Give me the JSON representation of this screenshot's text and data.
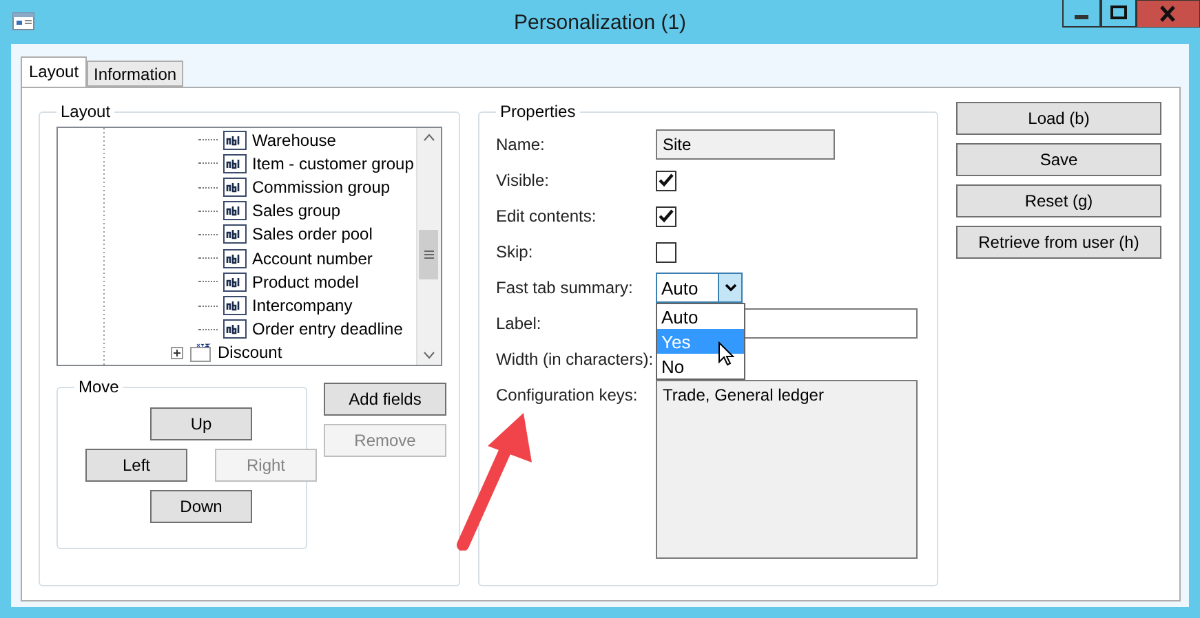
{
  "window": {
    "title": "Personalization (1)"
  },
  "tabs": [
    {
      "label": "Layout",
      "selected": true
    },
    {
      "label": "Information",
      "selected": false
    }
  ],
  "layout": {
    "title": "Layout",
    "tree": [
      {
        "kind": "field",
        "label": "Warehouse"
      },
      {
        "kind": "field",
        "label": "Item - customer group"
      },
      {
        "kind": "field",
        "label": "Commission group"
      },
      {
        "kind": "field",
        "label": "Sales group"
      },
      {
        "kind": "field",
        "label": "Sales order pool"
      },
      {
        "kind": "field",
        "label": "Account number"
      },
      {
        "kind": "field",
        "label": "Product model"
      },
      {
        "kind": "field",
        "label": "Intercompany"
      },
      {
        "kind": "field",
        "label": "Order entry deadline"
      },
      {
        "kind": "group",
        "label": "Discount",
        "expanded": false
      }
    ],
    "move": {
      "title": "Move",
      "up": {
        "label": "Up",
        "disabled": false
      },
      "left": {
        "label": "Left",
        "disabled": false
      },
      "right": {
        "label": "Right",
        "disabled": true
      },
      "down": {
        "label": "Down",
        "disabled": false
      }
    },
    "buttons": [
      {
        "label": "Add fields",
        "disabled": false
      },
      {
        "label": "Remove",
        "disabled": true
      }
    ]
  },
  "properties": {
    "title": "Properties",
    "fields": [
      {
        "kind": "text",
        "label": "Name:",
        "value": "Site"
      },
      {
        "kind": "checkbox",
        "label": "Visible:",
        "checked": true
      },
      {
        "kind": "checkbox",
        "label": "Edit contents:",
        "checked": true
      },
      {
        "kind": "checkbox",
        "label": "Skip:",
        "checked": false
      },
      {
        "kind": "combo",
        "label": "Fast tab summary:",
        "value": "Auto",
        "expanded": true,
        "options": [
          {
            "label": "Auto",
            "highlighted": false
          },
          {
            "label": "Yes",
            "highlighted": true
          },
          {
            "label": "No",
            "highlighted": false
          }
        ]
      },
      {
        "kind": "text",
        "label": "Label:"
      },
      {
        "kind": "plain",
        "label": "Width (in characters):"
      },
      {
        "kind": "area",
        "label": "Configuration keys:",
        "value": "Trade, General ledger"
      }
    ]
  },
  "actions": [
    {
      "label": "Load (b)"
    },
    {
      "label": "Save"
    },
    {
      "label": "Reset (g)"
    },
    {
      "label": "Retrieve from user (h)"
    }
  ]
}
